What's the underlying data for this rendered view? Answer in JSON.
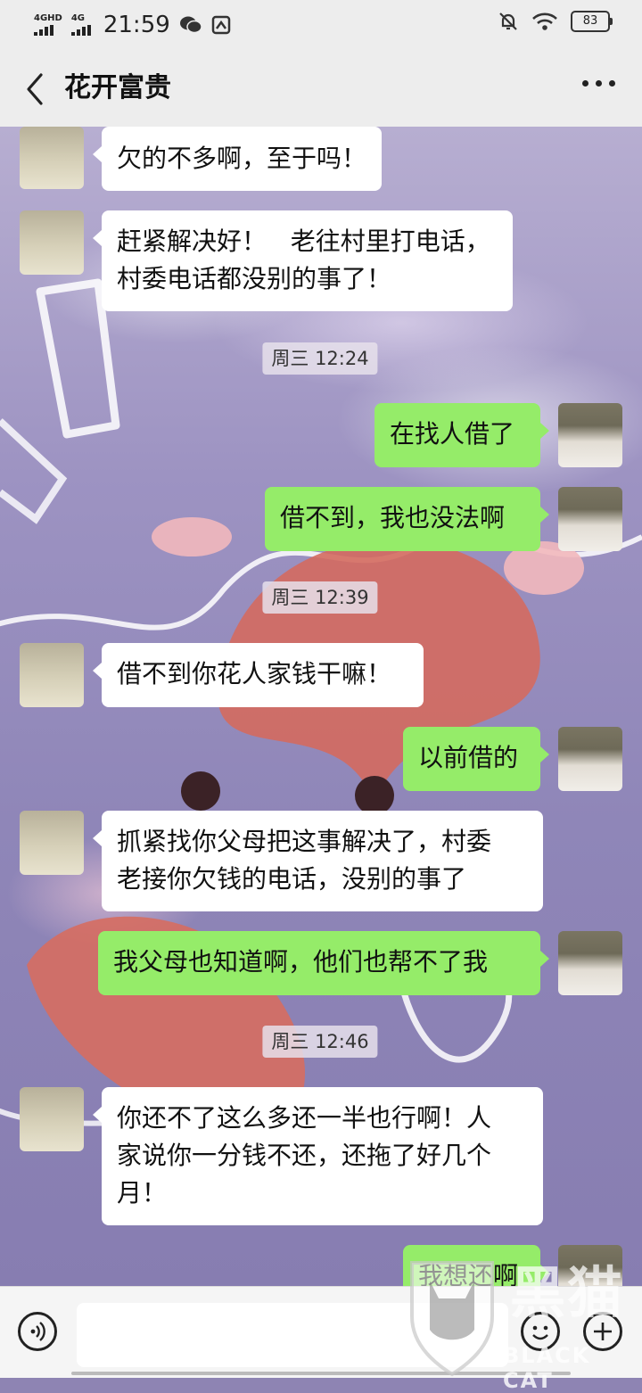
{
  "status_bar": {
    "signal1": "4GHD",
    "signal2": "4G",
    "time": "21:59",
    "battery": "83"
  },
  "header": {
    "title": "花开富贵"
  },
  "messages": [
    {
      "side": "in",
      "text": "欠的不多啊，至于吗！"
    },
    {
      "side": "in",
      "text": "赶紧解决好！   老往村里打电话，\n村委电话都没别的事了！"
    },
    {
      "side": "stamp",
      "text": "周三 12:24"
    },
    {
      "side": "out",
      "text": "在找人借了"
    },
    {
      "side": "out",
      "text": "借不到，我也没法啊"
    },
    {
      "side": "stamp",
      "text": "周三 12:39"
    },
    {
      "side": "in",
      "text": "借不到你花人家钱干嘛！"
    },
    {
      "side": "out",
      "text": "以前借的"
    },
    {
      "side": "in",
      "text": "抓紧找你父母把这事解决了，村委\n老接你欠钱的电话，没别的事了"
    },
    {
      "side": "out",
      "text": "我父母也知道啊，他们也帮不了我"
    },
    {
      "side": "stamp",
      "text": "周三 12:46"
    },
    {
      "side": "in",
      "text": "你还不了这么多还一半也行啊！人\n家说你一分钱不还，还拖了好几个\n月！"
    },
    {
      "side": "out",
      "text": "我想还啊"
    }
  ],
  "input_bar": {
    "placeholder": ""
  },
  "watermark": {
    "cn": "黑猫",
    "en": "BLACK CAT"
  },
  "colors": {
    "outgoing_bubble": "#95ec69",
    "incoming_bubble": "#ffffff",
    "bar_background": "#ededed"
  },
  "icons": [
    "back-chevron-icon",
    "more-dots-icon",
    "voice-icon",
    "emoji-icon",
    "plus-icon",
    "wechat-icon",
    "mute-bell-icon",
    "wifi-icon"
  ]
}
